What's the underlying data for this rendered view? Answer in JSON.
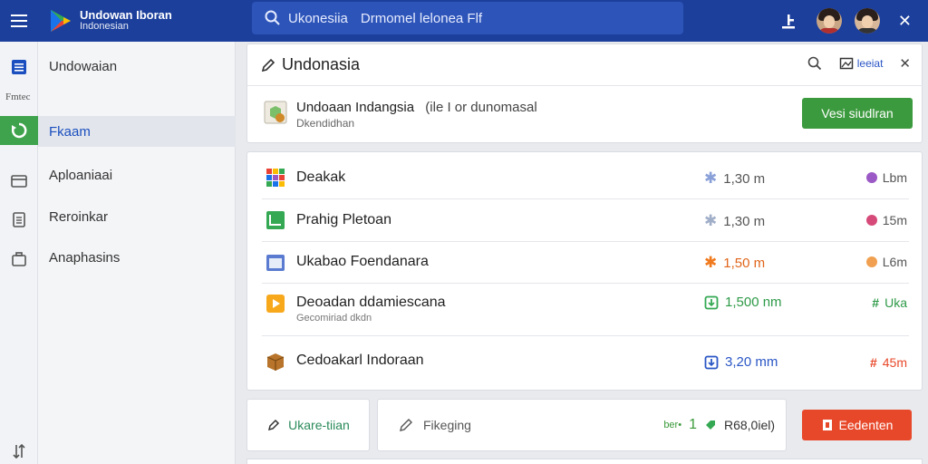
{
  "header": {
    "app_title": "Undowan Iboran",
    "app_subtitle": "Indonesian",
    "search_query_1": "Ukonesiia",
    "search_query_2": "Drmomel lelonea Flf"
  },
  "rail": {
    "label": "Fmtec"
  },
  "sidebar": {
    "items": [
      {
        "label": "Undowaian"
      },
      {
        "label": "Fkaam"
      },
      {
        "label": "Aploaniaai"
      },
      {
        "label": "Reroinkar"
      },
      {
        "label": "Anaphasins"
      }
    ]
  },
  "panel": {
    "title": "Undonasia",
    "share_label": "leeiat",
    "package_title": "Undoaan Indangsia",
    "package_extra": "(ile I or dunomasal",
    "package_sub": "Dkendidhan",
    "primary_button": "Vesi siudlran"
  },
  "items": [
    {
      "name": "Deakak",
      "sub": "",
      "size": "1,30 m",
      "size_icon": "star-icon",
      "size_color": "#8aa0d8",
      "meta": "Lbm",
      "meta_color": "#9b59c6"
    },
    {
      "name": "Prahig Pletoan",
      "sub": "",
      "size": "1,30 m",
      "size_icon": "star-icon",
      "size_color": "#a0aec8",
      "meta": "15m",
      "meta_color": "#d64a7a"
    },
    {
      "name": "Ukabao Foendanara",
      "sub": "",
      "size": "1,50 m",
      "size_icon": "star-icon",
      "size_color": "#f07a1e",
      "meta": "L6m",
      "meta_color": "#f0a050"
    },
    {
      "name": "Deoadan ddamiescana",
      "sub": "Gecomiriad dkdn",
      "size": "1,500 nm",
      "size_icon": "download-icon",
      "size_color": "#34a853",
      "meta": "Uka",
      "meta_color": "#34a853"
    },
    {
      "name": "Cedoakarl Indoraan",
      "sub": "",
      "size": "3,20 mm",
      "size_icon": "download-icon",
      "size_color": "#2a56c5",
      "meta": "45m",
      "meta_color": "#e8482a"
    }
  ],
  "bottom": {
    "left_button": "Ukare-tiian",
    "edit_label": "Fikeging",
    "small_label": "ber•",
    "count": "1",
    "amount": "R68,0iel)",
    "danger_button": "Eedenten"
  },
  "colors": {
    "topbar": "#1c3f9c",
    "primary": "#3c9a3e",
    "danger": "#e8482a",
    "accent": "#1b4fbf"
  }
}
